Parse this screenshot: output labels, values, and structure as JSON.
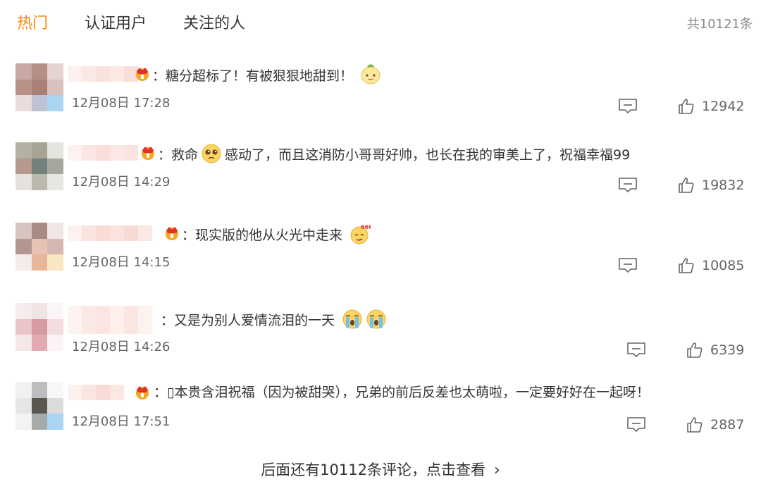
{
  "tabs": [
    "热门",
    "认证用户",
    "关注的人"
  ],
  "total_label": "共10121条",
  "colors": {
    "accent": "#ff8200",
    "text": "#333333",
    "muted": "#666666"
  },
  "comments": [
    {
      "text": "：糖分超标了！有被狠狠地甜到！",
      "time": "12月08日 17:28",
      "likes": "12942",
      "emoji": "lemon-face"
    },
    {
      "text": "：救命",
      "text2": "感动了，而且这消防小哥哥好帅，也长在我的审美上了，祝福幸福99",
      "time": "12月08日 14:29",
      "likes": "19832",
      "emoji": "pleading-face"
    },
    {
      "text": "：现实版的他从火光中走来",
      "time": "12月08日 14:15",
      "likes": "10085",
      "emoji": "666-face"
    },
    {
      "text": "：又是为别人爱情流泪的一天",
      "time": "12月08日 14:26",
      "likes": "6339",
      "emoji": "crying-face"
    },
    {
      "text": "：▯本贵含泪祝福（因为被甜哭），兄弟的前后反差也太萌啦，一定要好好在一起呀！",
      "time": "12月08日 17:51",
      "likes": "2887"
    }
  ],
  "more_label": "后面还有10112条评论，点击查看",
  "more_chevron": "›"
}
